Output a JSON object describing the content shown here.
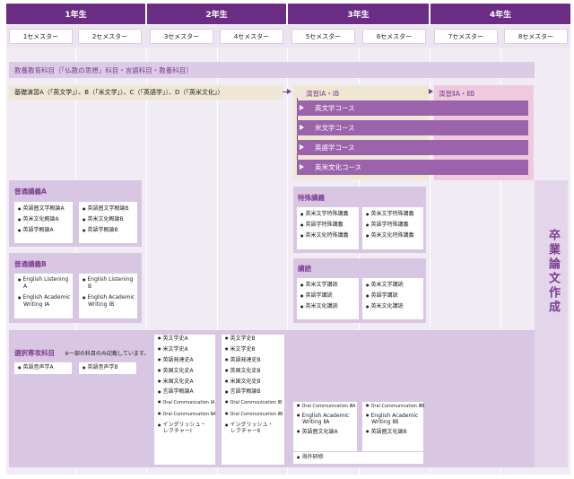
{
  "years": [
    "1年生",
    "2年生",
    "3年生",
    "4年生"
  ],
  "semesters": [
    "1セメスター",
    "2セメスター",
    "3セメスター",
    "4セメスター",
    "5セメスター",
    "6セメスター",
    "7セメスター",
    "8セメスター"
  ],
  "liberal": "教養教育科目（「仏教の思想」科目・言語科目・教養科目）",
  "basic_seminar": "基礎演習A（「英文学」）、B（「米文学」）、C（「英語学」）、D（「英米文化」）",
  "seminar1": "演習ⅠA・ⅠB",
  "seminar2": "演習ⅡA・ⅡB",
  "courses": [
    "英文学コース",
    "米文学コース",
    "英語学コース",
    "英米文化コース"
  ],
  "general_a": {
    "title": "普通講義A",
    "left": [
      "英語圏文学概論A",
      "英米文化概論A",
      "英語学概論A"
    ],
    "right": [
      "英語圏文学概論B",
      "英米文化概論B",
      "英語学概論B"
    ]
  },
  "general_b": {
    "title": "普通講義B",
    "left": [
      "English Listening",
      "A",
      "English Academic",
      "Writing ⅠA"
    ],
    "right": [
      "English Listening",
      "B",
      "English Academic",
      "Writing ⅠB"
    ]
  },
  "special": {
    "title": "特殊講義",
    "left": [
      "英米文学特殊講義",
      "英語学特殊講義",
      "英米文化特殊講義"
    ],
    "right": [
      "英米文学特殊講義",
      "英語学特殊講義",
      "英米文化特殊講義"
    ]
  },
  "reading": {
    "title": "講読",
    "left": [
      "英米文学講読",
      "英語学講読",
      "英米文化講読"
    ],
    "right": [
      "英米文学講読",
      "英語学講読",
      "英米文化講読"
    ]
  },
  "elective": {
    "title": "選択専攻科目",
    "note": "※一部の科目のみ記載しています。",
    "a": "英語音声学A",
    "b": "英語音声学B",
    "col3": [
      "英文学史A",
      "米文学史A",
      "英語発達史A",
      "英国文化史A",
      "米国文化史A",
      "言語学概論A",
      "Oral Communication ⅠA",
      "Oral Communication ⅡA",
      "イングリッシュ・",
      "レクチャーⅠ"
    ],
    "col4": [
      "英文学史B",
      "米文学史B",
      "英語発達史B",
      "英国文化史B",
      "米国文化史B",
      "言語学概論B",
      "Oral Communication ⅠB",
      "Oral Communication ⅡB",
      "イングリッシュ・",
      "レクチャーⅡ"
    ],
    "col5": [
      "Oral Communication ⅢA",
      "English Academic",
      "Writing ⅡA",
      "英語圏文化論A",
      "海外研修"
    ],
    "col6": [
      "Oral Communication ⅢB",
      "English Academic",
      "Writing ⅡB",
      "英語圏文化論B"
    ]
  },
  "thesis": "卒業論文作成"
}
